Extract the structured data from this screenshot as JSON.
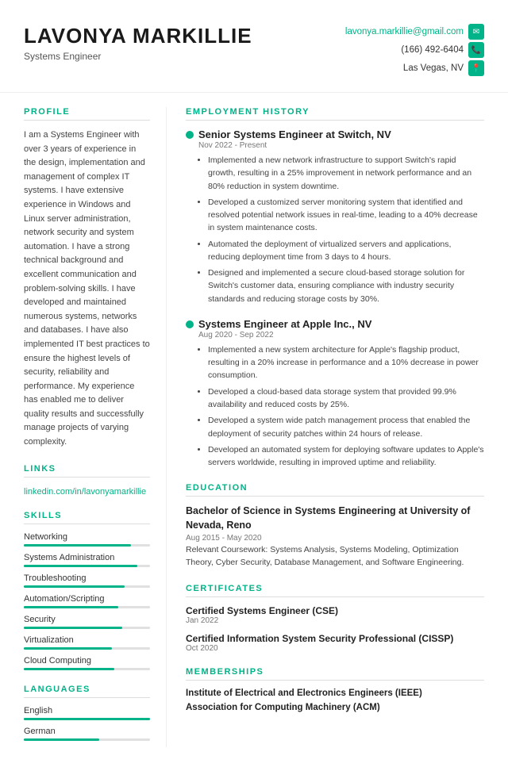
{
  "header": {
    "name": "LAVONYA MARKILLIE",
    "subtitle": "Systems Engineer",
    "email": "lavonya.markillie@gmail.com",
    "phone": "(166) 492-6404",
    "location": "Las Vegas, NV"
  },
  "profile": {
    "title": "PROFILE",
    "text": "I am a Systems Engineer with over 3 years of experience in the design, implementation and management of complex IT systems. I have extensive experience in Windows and Linux server administration, network security and system automation. I have a strong technical background and excellent communication and problem-solving skills. I have developed and maintained numerous systems, networks and databases. I have also implemented IT best practices to ensure the highest levels of security, reliability and performance. My experience has enabled me to deliver quality results and successfully manage projects of varying complexity."
  },
  "links": {
    "title": "LINKS",
    "items": [
      {
        "label": "linkedin.com/in/lavonyamarkillie",
        "url": "#"
      }
    ]
  },
  "skills": {
    "title": "SKILLS",
    "items": [
      {
        "name": "Networking",
        "percent": 85
      },
      {
        "name": "Systems Administration",
        "percent": 90
      },
      {
        "name": "Troubleshooting",
        "percent": 80
      },
      {
        "name": "Automation/Scripting",
        "percent": 75
      },
      {
        "name": "Security",
        "percent": 78
      },
      {
        "name": "Virtualization",
        "percent": 70
      },
      {
        "name": "Cloud Computing",
        "percent": 72
      }
    ]
  },
  "languages": {
    "title": "LANGUAGES",
    "items": [
      {
        "name": "English",
        "percent": 100
      },
      {
        "name": "German",
        "percent": 60
      }
    ]
  },
  "employment": {
    "title": "EMPLOYMENT HISTORY",
    "jobs": [
      {
        "title": "Senior Systems Engineer at Switch, NV",
        "dates": "Nov 2022 - Present",
        "bullets": [
          "Implemented a new network infrastructure to support Switch's rapid growth, resulting in a 25% improvement in network performance and an 80% reduction in system downtime.",
          "Developed a customized server monitoring system that identified and resolved potential network issues in real-time, leading to a 40% decrease in system maintenance costs.",
          "Automated the deployment of virtualized servers and applications, reducing deployment time from 3 days to 4 hours.",
          "Designed and implemented a secure cloud-based storage solution for Switch's customer data, ensuring compliance with industry security standards and reducing storage costs by 30%."
        ]
      },
      {
        "title": "Systems Engineer at Apple Inc., NV",
        "dates": "Aug 2020 - Sep 2022",
        "bullets": [
          "Implemented a new system architecture for Apple's flagship product, resulting in a 20% increase in performance and a 10% decrease in power consumption.",
          "Developed a cloud-based data storage system that provided 99.9% availability and reduced costs by 25%.",
          "Developed a system wide patch management process that enabled the deployment of security patches within 24 hours of release.",
          "Developed an automated system for deploying software updates to Apple's servers worldwide, resulting in improved uptime and reliability."
        ]
      }
    ]
  },
  "education": {
    "title": "EDUCATION",
    "degree": "Bachelor of Science in Systems Engineering at University of Nevada, Reno",
    "dates": "Aug 2015 - May 2020",
    "text": "Relevant Coursework: Systems Analysis, Systems Modeling, Optimization Theory, Cyber Security, Database Management, and Software Engineering."
  },
  "certificates": {
    "title": "CERTIFICATES",
    "items": [
      {
        "title": "Certified Systems Engineer (CSE)",
        "date": "Jan 2022"
      },
      {
        "title": "Certified Information System Security Professional (CISSP)",
        "date": "Oct 2020"
      }
    ]
  },
  "memberships": {
    "title": "MEMBERSHIPS",
    "items": [
      "Institute of Electrical and Electronics Engineers (IEEE)",
      "Association for Computing Machinery (ACM)"
    ]
  }
}
